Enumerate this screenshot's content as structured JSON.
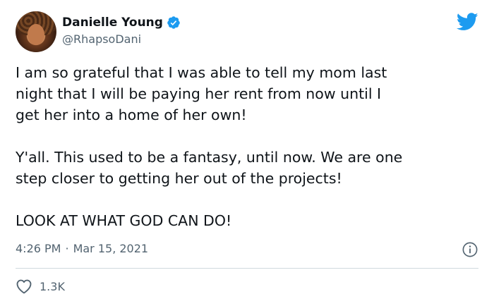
{
  "author": {
    "name": "Danielle Young",
    "handle": "@RhapsoDani",
    "verified": true
  },
  "tweet": {
    "paragraphs": [
      "I am so grateful that I was able to tell my mom last\nnight that I will be paying her rent from now until I\nget her into a home of her own!",
      "Y'all. This used to be a fantasy, until now. We are one\nstep closer to getting her out of the projects!",
      "LOOK AT WHAT GOD CAN DO!"
    ],
    "time": "4:26 PM",
    "separator": "·",
    "date": "Mar 15, 2021",
    "likes": "1.3K"
  },
  "colors": {
    "text": "#0f1419",
    "secondary": "#536471",
    "twitter_blue": "#1d9bf0",
    "divider": "#cfd9de"
  },
  "icons": [
    "verified-badge-icon",
    "twitter-bird-icon",
    "info-icon",
    "heart-icon"
  ]
}
